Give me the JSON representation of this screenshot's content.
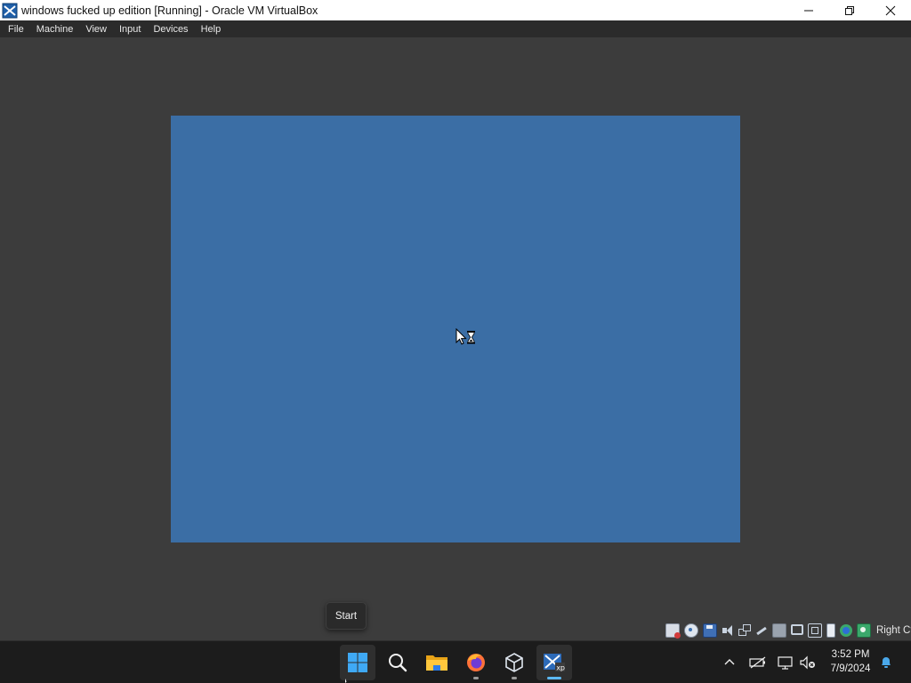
{
  "window": {
    "title": "windows fucked up edition [Running] - Oracle VM VirtualBox",
    "controls": [
      "minimize-icon",
      "maximize-icon",
      "close-icon"
    ]
  },
  "menubar": {
    "items": [
      "File",
      "Machine",
      "View",
      "Input",
      "Devices",
      "Help"
    ]
  },
  "vm": {
    "guest_background": "#3b6ea5",
    "cursor": "busy-arrow-hourglass"
  },
  "statusbar": {
    "icons": [
      "hard-disk-icon",
      "optical-disk-icon",
      "floppy-icon",
      "audio-icon",
      "network-icon",
      "usb-icon",
      "shared-folders-icon",
      "display-icon",
      "recording-icon",
      "vt-x-icon",
      "guest-additions-icon",
      "mouse-integration-icon"
    ],
    "host_key": "Right Ctrl"
  },
  "tooltip": {
    "text": "Start"
  },
  "taskbar": {
    "apps": [
      {
        "name": "start-button",
        "icon": "windows-logo-icon",
        "state": "hover"
      },
      {
        "name": "search-button",
        "icon": "search-icon",
        "state": "normal"
      },
      {
        "name": "file-explorer",
        "icon": "folder-icon",
        "state": "normal"
      },
      {
        "name": "firefox",
        "icon": "firefox-icon",
        "state": "running"
      },
      {
        "name": "virtualbox-manager",
        "icon": "virtualbox-cube-icon",
        "state": "running"
      },
      {
        "name": "virtualbox-vm-window",
        "icon": "virtualbox-xp-icon",
        "state": "active"
      }
    ],
    "tray": {
      "icons": [
        "chevron-up-icon",
        "battery-plugged-icon",
        "network-monitor-icon",
        "volume-muted-icon",
        "notification-bell-icon"
      ],
      "time": "3:52 PM",
      "date": "7/9/2024"
    }
  },
  "colors": {
    "accent_blue": "#5cb8f2",
    "titlebar_bg": "#ffffff",
    "menubar_bg": "#2b2b2b",
    "host_bg": "#3c3c3c",
    "taskbar_bg": "#1c1c1c"
  }
}
